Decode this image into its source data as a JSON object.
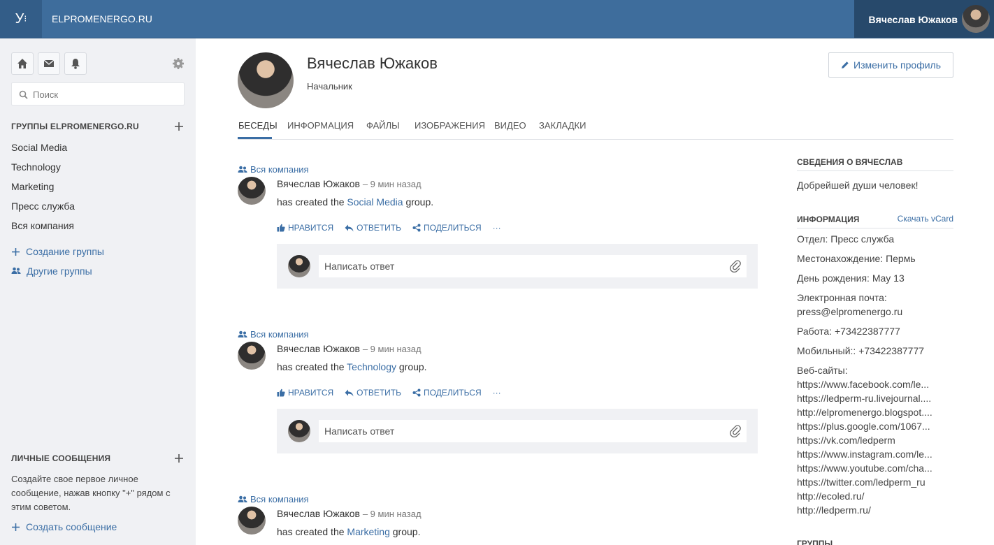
{
  "topbar": {
    "logo": "У",
    "network": "ELPROMENERGO.RU",
    "user_name": "Вячеслав Южаков"
  },
  "sidebar": {
    "search_placeholder": "Поиск",
    "groups_title": "ГРУППЫ ELPROMENERGO.RU",
    "groups": [
      "Social Media",
      "Technology",
      "Marketing",
      "Пресс служба",
      "Вся компания"
    ],
    "create_group": "Создание группы",
    "other_groups": "Другие группы",
    "pm_title": "ЛИЧНЫЕ СООБЩЕНИЯ",
    "pm_hint": "Создайте свое первое личное сообщение, нажав кнопку \"+\" рядом с этим советом.",
    "create_message": "Создать сообщение"
  },
  "profile": {
    "name": "Вячеслав Южаков",
    "role": "Начальник",
    "edit_label": "Изменить профиль"
  },
  "tabs": [
    "БЕСЕДЫ",
    "ИНФОРМАЦИЯ",
    "ФАЙЛЫ",
    "ИЗОБРАЖЕНИЯ",
    "ВИДЕО",
    "ЗАКЛАДКИ"
  ],
  "posts": [
    {
      "group": "Вся компания",
      "author": "Вячеслав Южаков",
      "time": "– 9 мин назад",
      "prefix": "has created the ",
      "link": "Social Media",
      "suffix": " group."
    },
    {
      "group": "Вся компания",
      "author": "Вячеслав Южаков",
      "time": "– 9 мин назад",
      "prefix": "has created the ",
      "link": "Technology",
      "suffix": " group."
    },
    {
      "group": "Вся компания",
      "author": "Вячеслав Южаков",
      "time": "– 9 мин назад",
      "prefix": "has created the ",
      "link": "Marketing",
      "suffix": " group."
    }
  ],
  "actions": {
    "like": "НРАВИТСЯ",
    "reply": "ОТВЕТИТЬ",
    "share": "ПОДЕЛИТЬСЯ",
    "more": "···"
  },
  "reply_placeholder": "Написать ответ",
  "right": {
    "about_title": "СВЕДЕНИЯ О ВЯЧЕСЛАВ",
    "about_text": "Добрейшей души человек!",
    "info_title": "ИНФОРМАЦИЯ",
    "vcard": "Скачать vCard",
    "department": "Отдел: Пресс служба",
    "location": "Местонахождение: Пермь",
    "birthday": "День рождения: May 13",
    "email_label": "Электронная почта:",
    "email": "press@elpromenergo.ru",
    "work": "Работа: +73422387777",
    "mobile": "Мобильный:: +73422387777",
    "websites_label": "Веб-сайты:",
    "websites": [
      "https://www.facebook.com/le...",
      "https://ledperm-ru.livejournal....",
      "http://elpromenergo.blogspot....",
      "https://plus.google.com/1067...",
      "https://vk.com/ledperm",
      "https://www.instagram.com/le...",
      "https://www.youtube.com/cha...",
      "https://twitter.com/ledperm_ru",
      "http://ecoled.ru/",
      "http://ledperm.ru/"
    ],
    "groups_title": "ГРУППЫ"
  }
}
